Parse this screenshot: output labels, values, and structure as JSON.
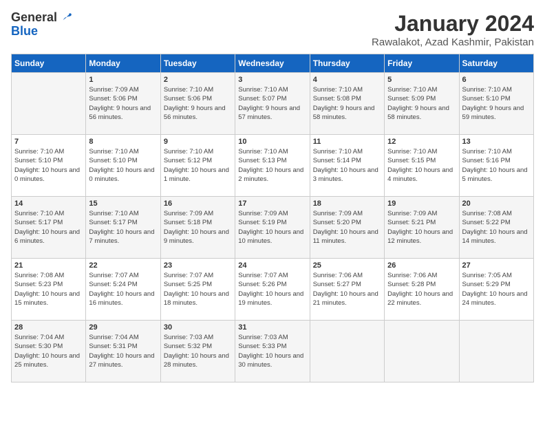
{
  "header": {
    "logo_general": "General",
    "logo_blue": "Blue",
    "month": "January 2024",
    "location": "Rawalakot, Azad Kashmir, Pakistan"
  },
  "days_of_week": [
    "Sunday",
    "Monday",
    "Tuesday",
    "Wednesday",
    "Thursday",
    "Friday",
    "Saturday"
  ],
  "weeks": [
    [
      {
        "day": "",
        "info": ""
      },
      {
        "day": "1",
        "info": "Sunrise: 7:09 AM\nSunset: 5:06 PM\nDaylight: 9 hours\nand 56 minutes."
      },
      {
        "day": "2",
        "info": "Sunrise: 7:10 AM\nSunset: 5:06 PM\nDaylight: 9 hours\nand 56 minutes."
      },
      {
        "day": "3",
        "info": "Sunrise: 7:10 AM\nSunset: 5:07 PM\nDaylight: 9 hours\nand 57 minutes."
      },
      {
        "day": "4",
        "info": "Sunrise: 7:10 AM\nSunset: 5:08 PM\nDaylight: 9 hours\nand 58 minutes."
      },
      {
        "day": "5",
        "info": "Sunrise: 7:10 AM\nSunset: 5:09 PM\nDaylight: 9 hours\nand 58 minutes."
      },
      {
        "day": "6",
        "info": "Sunrise: 7:10 AM\nSunset: 5:10 PM\nDaylight: 9 hours\nand 59 minutes."
      }
    ],
    [
      {
        "day": "7",
        "info": "Sunrise: 7:10 AM\nSunset: 5:10 PM\nDaylight: 10 hours\nand 0 minutes."
      },
      {
        "day": "8",
        "info": "Sunrise: 7:10 AM\nSunset: 5:10 PM\nDaylight: 10 hours\nand 0 minutes."
      },
      {
        "day": "9",
        "info": "Sunrise: 7:10 AM\nSunset: 5:12 PM\nDaylight: 10 hours\nand 1 minute."
      },
      {
        "day": "10",
        "info": "Sunrise: 7:10 AM\nSunset: 5:13 PM\nDaylight: 10 hours\nand 2 minutes."
      },
      {
        "day": "11",
        "info": "Sunrise: 7:10 AM\nSunset: 5:14 PM\nDaylight: 10 hours\nand 3 minutes."
      },
      {
        "day": "12",
        "info": "Sunrise: 7:10 AM\nSunset: 5:15 PM\nDaylight: 10 hours\nand 4 minutes."
      },
      {
        "day": "13",
        "info": "Sunrise: 7:10 AM\nSunset: 5:16 PM\nDaylight: 10 hours\nand 5 minutes."
      }
    ],
    [
      {
        "day": "14",
        "info": "Sunrise: 7:10 AM\nSunset: 5:17 PM\nDaylight: 10 hours\nand 6 minutes."
      },
      {
        "day": "15",
        "info": "Sunrise: 7:10 AM\nSunset: 5:17 PM\nDaylight: 10 hours\nand 7 minutes."
      },
      {
        "day": "16",
        "info": "Sunrise: 7:09 AM\nSunset: 5:18 PM\nDaylight: 10 hours\nand 9 minutes."
      },
      {
        "day": "17",
        "info": "Sunrise: 7:09 AM\nSunset: 5:19 PM\nDaylight: 10 hours\nand 10 minutes."
      },
      {
        "day": "18",
        "info": "Sunrise: 7:09 AM\nSunset: 5:20 PM\nDaylight: 10 hours\nand 11 minutes."
      },
      {
        "day": "19",
        "info": "Sunrise: 7:09 AM\nSunset: 5:21 PM\nDaylight: 10 hours\nand 12 minutes."
      },
      {
        "day": "20",
        "info": "Sunrise: 7:08 AM\nSunset: 5:22 PM\nDaylight: 10 hours\nand 14 minutes."
      }
    ],
    [
      {
        "day": "21",
        "info": "Sunrise: 7:08 AM\nSunset: 5:23 PM\nDaylight: 10 hours\nand 15 minutes."
      },
      {
        "day": "22",
        "info": "Sunrise: 7:07 AM\nSunset: 5:24 PM\nDaylight: 10 hours\nand 16 minutes."
      },
      {
        "day": "23",
        "info": "Sunrise: 7:07 AM\nSunset: 5:25 PM\nDaylight: 10 hours\nand 18 minutes."
      },
      {
        "day": "24",
        "info": "Sunrise: 7:07 AM\nSunset: 5:26 PM\nDaylight: 10 hours\nand 19 minutes."
      },
      {
        "day": "25",
        "info": "Sunrise: 7:06 AM\nSunset: 5:27 PM\nDaylight: 10 hours\nand 21 minutes."
      },
      {
        "day": "26",
        "info": "Sunrise: 7:06 AM\nSunset: 5:28 PM\nDaylight: 10 hours\nand 22 minutes."
      },
      {
        "day": "27",
        "info": "Sunrise: 7:05 AM\nSunset: 5:29 PM\nDaylight: 10 hours\nand 24 minutes."
      }
    ],
    [
      {
        "day": "28",
        "info": "Sunrise: 7:04 AM\nSunset: 5:30 PM\nDaylight: 10 hours\nand 25 minutes."
      },
      {
        "day": "29",
        "info": "Sunrise: 7:04 AM\nSunset: 5:31 PM\nDaylight: 10 hours\nand 27 minutes."
      },
      {
        "day": "30",
        "info": "Sunrise: 7:03 AM\nSunset: 5:32 PM\nDaylight: 10 hours\nand 28 minutes."
      },
      {
        "day": "31",
        "info": "Sunrise: 7:03 AM\nSunset: 5:33 PM\nDaylight: 10 hours\nand 30 minutes."
      },
      {
        "day": "",
        "info": ""
      },
      {
        "day": "",
        "info": ""
      },
      {
        "day": "",
        "info": ""
      }
    ]
  ]
}
